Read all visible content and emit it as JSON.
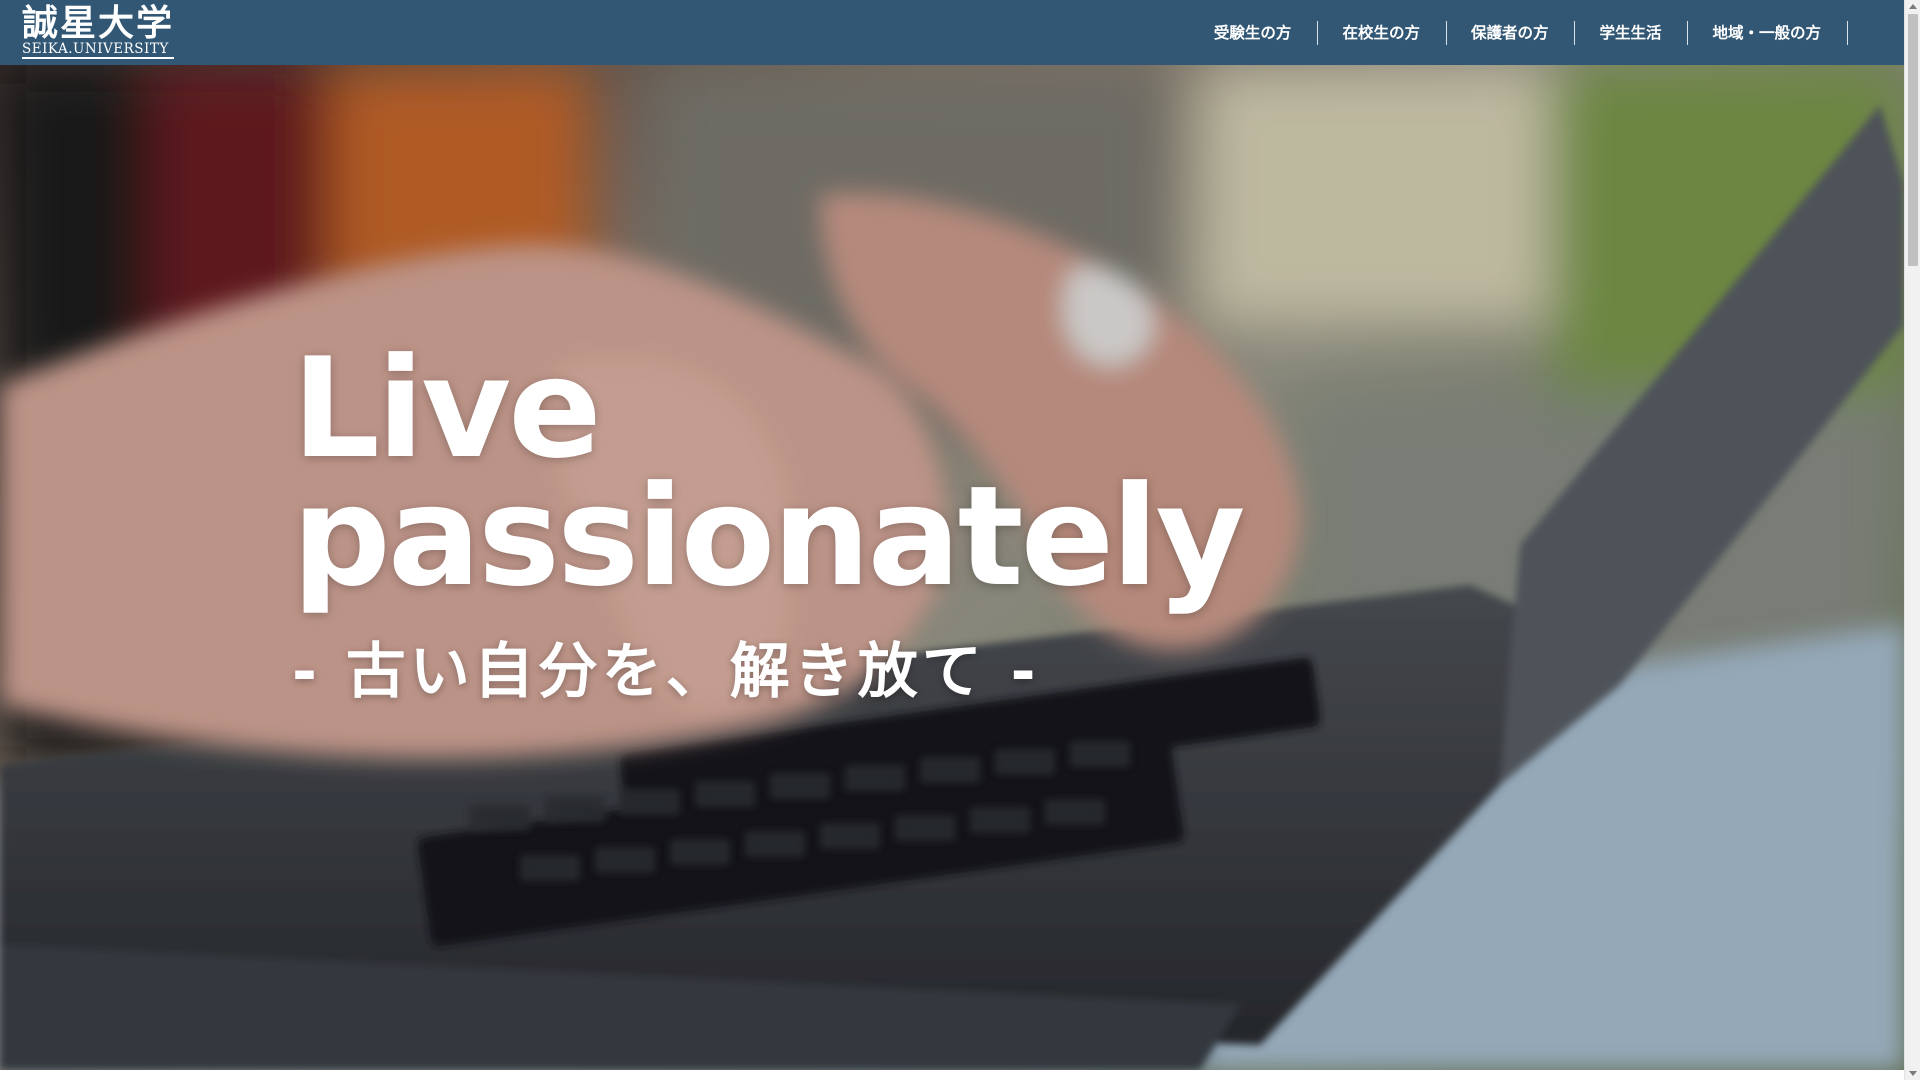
{
  "header": {
    "logo_kanji": "誠星大学",
    "logo_en": "SEIKA.UNIVERSITY",
    "nav": [
      {
        "label": "受験生の方"
      },
      {
        "label": "在校生の方"
      },
      {
        "label": "保護者の方"
      },
      {
        "label": "学生生活"
      },
      {
        "label": "地域・一般の方"
      }
    ]
  },
  "hero": {
    "title_line1": "Live",
    "title_line2": "passionately",
    "subtitle": "- 古い自分を、解き放て -",
    "image": "blurred-photo-hands-typing-on-laptop"
  },
  "colors": {
    "header_bg": "#315774",
    "text": "#ffffff"
  }
}
